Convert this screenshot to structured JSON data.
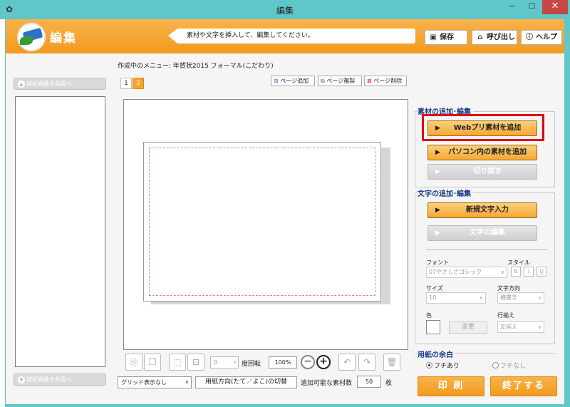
{
  "window": {
    "title": "編集",
    "controls": {
      "minimize": "–",
      "maximize": "□",
      "close": "✕"
    }
  },
  "header": {
    "title": "編集",
    "hint": "素材や文字を挿入して、編集してください。",
    "buttons": {
      "save": "保存",
      "load": "呼び出し",
      "help": "ヘルプ"
    },
    "icons": {
      "save": "floppy-disk-icon",
      "load": "folder-open-icon",
      "help": "help-circle-icon"
    }
  },
  "left_panel": {
    "front_button": "選択画像を前面へ",
    "back_button": "選択画像を背面へ"
  },
  "editor": {
    "menu_label": "作成中のメニュー: 年賀状2015 フォーマル(こだわり)",
    "tabs": [
      "1",
      "2"
    ],
    "active_tab": "2",
    "page_buttons": {
      "add": "ページ追加",
      "copy": "ページ複製",
      "delete": "ページ削除"
    }
  },
  "toolbar": {
    "rotation_value": "0",
    "rotation_label": "度回転",
    "zoom_value": "100%",
    "zoom_out": "−",
    "zoom_in": "+"
  },
  "bottom": {
    "grid_select": "グリッド表示なし",
    "orientation_button": "用紙方向(たて／よこ)の切替",
    "count_label": "追加可能な素材数",
    "count_value": "50",
    "count_unit": "枚"
  },
  "right_panel": {
    "material_title": "素材の追加･編集",
    "web_material": "Webプリ素材を追加",
    "pc_material": "パソコン内の素材を追加",
    "crop": "切り抜き",
    "text_title": "文字の追加･編集",
    "new_text": "新規文字入力",
    "edit_text": "文字の編集",
    "font_label": "フォント",
    "font_value": "07やさしさゴシック",
    "style_label": "スタイル",
    "style_bold": "B",
    "style_italic": "I",
    "style_underline": "U",
    "size_label": "サイズ",
    "size_value": "10",
    "direction_label": "文字方向",
    "direction_value": "横書き",
    "color_label": "色",
    "change_button": "変更",
    "align_label": "行揃え",
    "align_value": "左揃え",
    "margin_title": "用紙の余白",
    "margin_on": "フチあり",
    "margin_off": "フチなし",
    "margin_selected": "フチあり",
    "highlight_color": "#e0000a"
  },
  "footer_buttons": {
    "print": "印 刷",
    "exit": "終了する"
  },
  "colors": {
    "accent_orange": "#f29a1f",
    "titlebar_teal": "#5fc6c9",
    "heading_blue": "#1a3a8a"
  }
}
